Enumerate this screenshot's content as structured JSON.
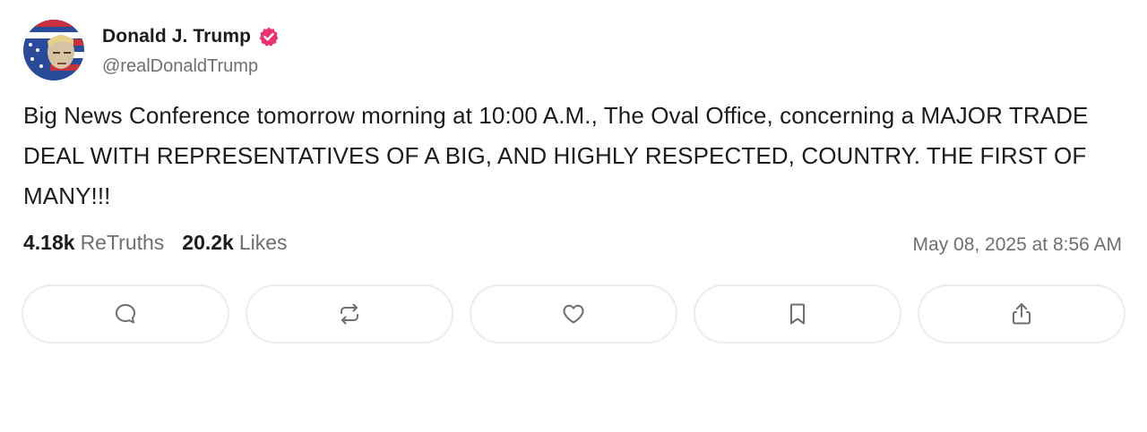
{
  "post": {
    "author": {
      "display_name": "Donald J. Trump",
      "handle": "@realDonaldTrump",
      "verified": true,
      "verified_color": "#e8336d"
    },
    "text": "Big News Conference tomorrow morning at 10:00 A.M., The Oval Office, concerning a MAJOR TRADE DEAL WITH REPRESENTATIVES OF A BIG, AND HIGHLY RESPECTED, COUNTRY. THE FIRST OF MANY!!!",
    "stats": {
      "retruths_count": "4.18k",
      "retruths_label": "ReTruths",
      "likes_count": "20.2k",
      "likes_label": "Likes"
    },
    "timestamp": "May 08, 2025 at 8:56 AM"
  },
  "actions": [
    {
      "name": "reply",
      "icon": "comment-icon"
    },
    {
      "name": "retruth",
      "icon": "repost-icon"
    },
    {
      "name": "like",
      "icon": "heart-icon"
    },
    {
      "name": "bookmark",
      "icon": "bookmark-icon"
    },
    {
      "name": "share",
      "icon": "share-icon"
    }
  ],
  "colors": {
    "text": "#1c1c1e",
    "muted": "#6e6e73",
    "button_border": "#ececee"
  }
}
